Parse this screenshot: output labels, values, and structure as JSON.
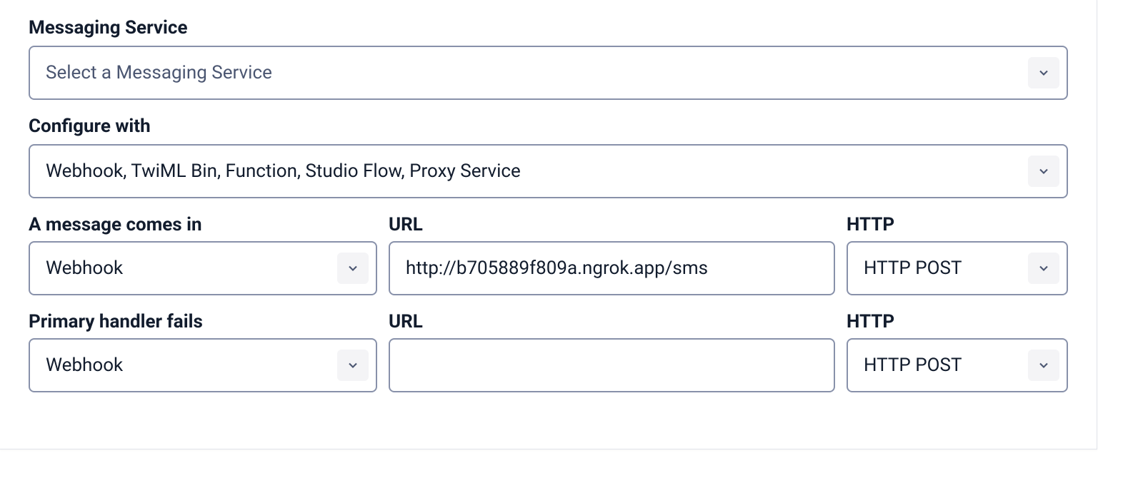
{
  "messaging_service": {
    "label": "Messaging Service",
    "value": "Select a Messaging Service"
  },
  "configure_with": {
    "label": "Configure with",
    "value": "Webhook, TwiML Bin, Function, Studio Flow, Proxy Service"
  },
  "message_comes_in": {
    "handler_label": "A message comes in",
    "handler_value": "Webhook",
    "url_label": "URL",
    "url_value": "http://b705889f809a.ngrok.app/sms",
    "http_label": "HTTP",
    "http_value": "HTTP POST"
  },
  "primary_fails": {
    "handler_label": "Primary handler fails",
    "handler_value": "Webhook",
    "url_label": "URL",
    "url_value": "",
    "http_label": "HTTP",
    "http_value": "HTTP POST"
  }
}
